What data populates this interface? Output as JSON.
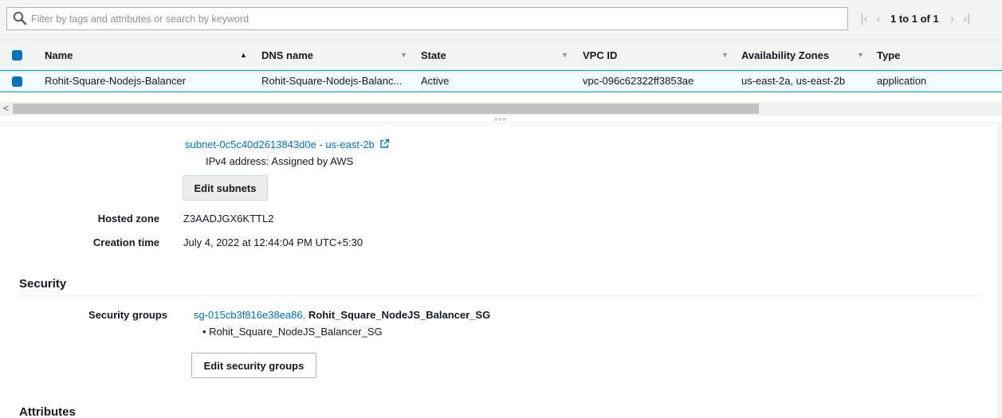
{
  "search": {
    "placeholder": "Filter by tags and attributes or search by keyword"
  },
  "pager": {
    "text": "1 to 1 of 1"
  },
  "table": {
    "columns": {
      "name": "Name",
      "dns": "DNS name",
      "state": "State",
      "vpc": "VPC ID",
      "az": "Availability Zones",
      "type": "Type"
    },
    "row": {
      "name": "Rohit-Square-Nodejs-Balancer",
      "dns": "Rohit-Square-Nodejs-Balanc...",
      "state": "Active",
      "vpc": "vpc-096c62322ff3853ae",
      "az": "us-east-2a, us-east-2b",
      "type": "application"
    }
  },
  "details": {
    "subnet_link": "subnet-0c5c40d2613843d0e - us-east-2b",
    "ipv4": "IPv4 address: Assigned by AWS",
    "edit_subnets": "Edit subnets",
    "hosted_zone_label": "Hosted zone",
    "hosted_zone_value": "Z3AADJGX6KTTL2",
    "creation_time_label": "Creation time",
    "creation_time_value": "July 4, 2022 at 12:44:04 PM UTC+5:30"
  },
  "security": {
    "heading": "Security",
    "groups_label": "Security groups",
    "sg_link": "sg-015cb3f816e38ea86",
    "sg_sep": ",",
    "sg_name": "Rohit_Square_NodeJS_Balancer_SG",
    "sg_bullet": "• Rohit_Square_NodeJS_Balancer_SG",
    "edit_button": "Edit security groups"
  },
  "attributes": {
    "heading": "Attributes"
  },
  "colors": {
    "link": "#0073bb",
    "checkbox": "#0073bb",
    "selected_row_bg": "#f1faff",
    "selected_row_border": "#00a1c9",
    "header_bg": "#f2f3f3"
  }
}
